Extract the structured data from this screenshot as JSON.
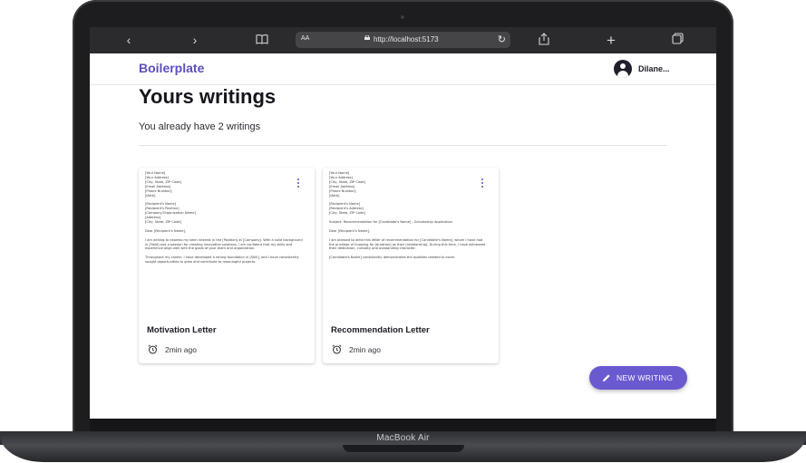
{
  "device": {
    "model_label": "MacBook Air"
  },
  "browser": {
    "url_prefix": "AA",
    "url": "http://localhost:5173"
  },
  "app": {
    "brand": "Boilerplate",
    "user_name": "Dilane...",
    "page_title": "Yours writings",
    "subtitle": "You already have 2 writings"
  },
  "writings": [
    {
      "title": "Motivation Letter",
      "time": "2min ago",
      "preview": "[Your Name]\n[Your Address]\n[City, State, ZIP Code]\n[Email Address]\n[Phone Number]\n[Date]\n\n[Recipient's Name]\n[Recipient's Position]\n[Company/Organization Name]\n[Address]\n[City, State, ZIP Code]\n\nDear [Recipient's Name],\n\nI am writing to express my keen interest in the [Position] at [Company]. With a solid background in [Field] and a passion for creating innovative solutions, I am confident that my skills and experience align well with the goals of your team and organization.\n\nThroughout my career, I have developed a strong foundation in [Skill], and I have consistently sought opportunities to grow and contribute to meaningful projects."
    },
    {
      "title": "Recommendation Letter",
      "time": "2min ago",
      "preview": "[Your Name]\n[Your Address]\n[City, State, ZIP Code]\n[Email Address]\n[Phone Number]\n[Date]\n\n[Recipient's Name]\n[Recipient's Address]\n[City, State, ZIP Code]\n\nSubject: Recommendation for [Candidate's Name] - Scholarship Application\n\nDear [Recipient's Name],\n\nI am pleased to write this letter of recommendation for [Candidate's Name], whom I have had the privilege of knowing for [duration] as their [relationship]. During this time, I have witnessed their dedication, curiosity and outstanding character.\n\n[Candidate's Name] consistently demonstrates the qualities needed to excel."
    }
  ],
  "fab": {
    "label": "NEW WRITING"
  },
  "colors": {
    "accent": "#6a5ad0",
    "brand": "#5b4fc0",
    "chrome": "#2b2b2d"
  }
}
